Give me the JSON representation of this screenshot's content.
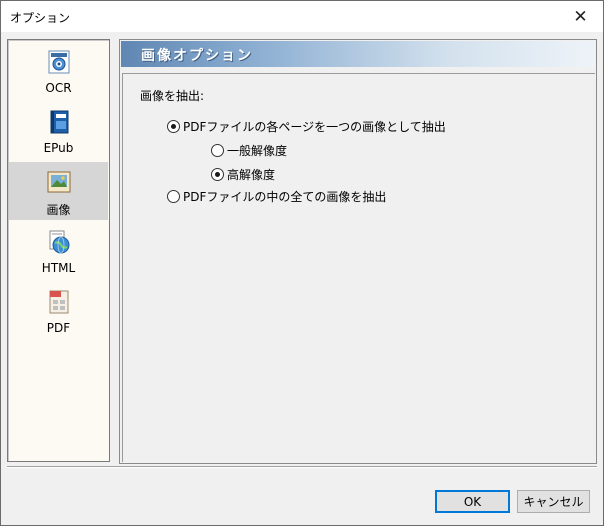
{
  "window": {
    "title": "オプション"
  },
  "sidebar": {
    "items": [
      {
        "label": "OCR",
        "icon": "ocr-icon",
        "selected": false
      },
      {
        "label": "EPub",
        "icon": "epub-book-icon",
        "selected": false
      },
      {
        "label": "画像",
        "icon": "image-icon",
        "selected": true
      },
      {
        "label": "HTML",
        "icon": "html-globe-icon",
        "selected": false
      },
      {
        "label": "PDF",
        "icon": "pdf-document-icon",
        "selected": false
      }
    ]
  },
  "panel": {
    "banner_title": "画像オプション",
    "extract_label": "画像を抽出:",
    "options": {
      "each_page": {
        "label": "PDFファイルの各ページを一つの画像として抽出",
        "checked": true
      },
      "normal_res": {
        "label": "一般解像度",
        "checked": false
      },
      "high_res": {
        "label": "高解像度",
        "checked": true
      },
      "all_images": {
        "label": "PDFファイルの中の全ての画像を抽出",
        "checked": false
      }
    }
  },
  "buttons": {
    "ok": "OK",
    "cancel": "キャンセル"
  },
  "colors": {
    "accent": "#0078d7",
    "banner_start": "#5f87b3",
    "selected_item": "#d6d6d6"
  }
}
